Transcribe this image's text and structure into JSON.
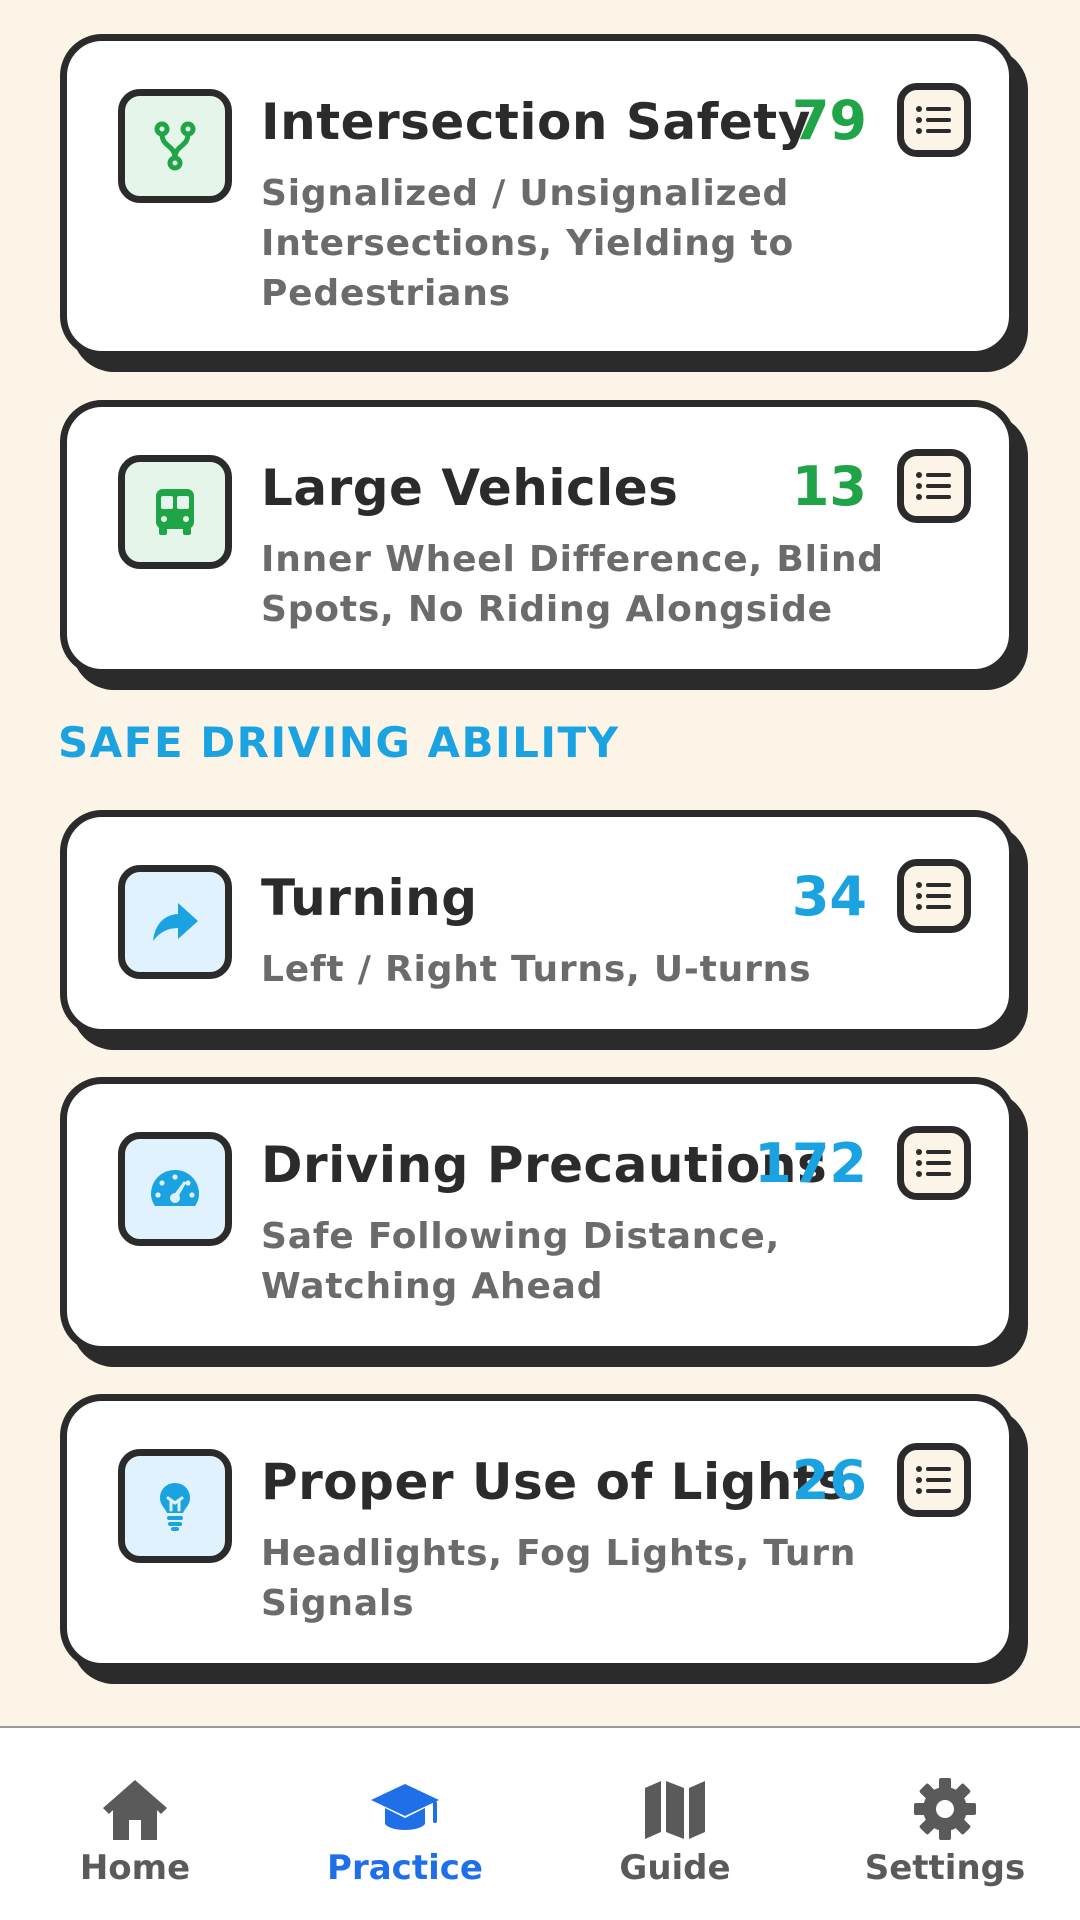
{
  "cards": [
    {
      "title": "Intersection Safety",
      "description": "Signalized / Unsignalized Intersections, Yielding to Pedestrians",
      "count": "79",
      "icon": "fork-icon",
      "color": "#1fa448"
    },
    {
      "title": "Large Vehicles",
      "description": "Inner Wheel Difference, Blind Spots, No Riding Alongside",
      "count": "13",
      "icon": "bus-icon",
      "color": "#1fa448"
    },
    {
      "title": "Turning",
      "description": "Left / Right Turns, U-turns",
      "count": "34",
      "icon": "turn-arrow-icon",
      "color": "#1aa3e0"
    },
    {
      "title": "Driving Precautions",
      "description": "Safe Following Distance, Watching Ahead",
      "count": "172",
      "icon": "speedometer-icon",
      "color": "#1aa3e0"
    },
    {
      "title": "Proper Use of Lights",
      "description": "Headlights, Fog Lights, Turn Signals",
      "count": "26",
      "icon": "lightbulb-icon",
      "color": "#1aa3e0"
    }
  ],
  "section": {
    "heading": "SAFE DRIVING ABILITY"
  },
  "nav": {
    "items": [
      {
        "label": "Home",
        "icon": "home-icon",
        "active": false
      },
      {
        "label": "Practice",
        "icon": "graduation-cap-icon",
        "active": true
      },
      {
        "label": "Guide",
        "icon": "map-icon",
        "active": false
      },
      {
        "label": "Settings",
        "icon": "gear-icon",
        "active": false
      }
    ],
    "active_color": "#1f6fe8",
    "inactive_color": "#5a5a5a"
  },
  "colors": {
    "background": "#fdf4e8",
    "green": "#1fa448",
    "blue": "#1aa3e0"
  }
}
